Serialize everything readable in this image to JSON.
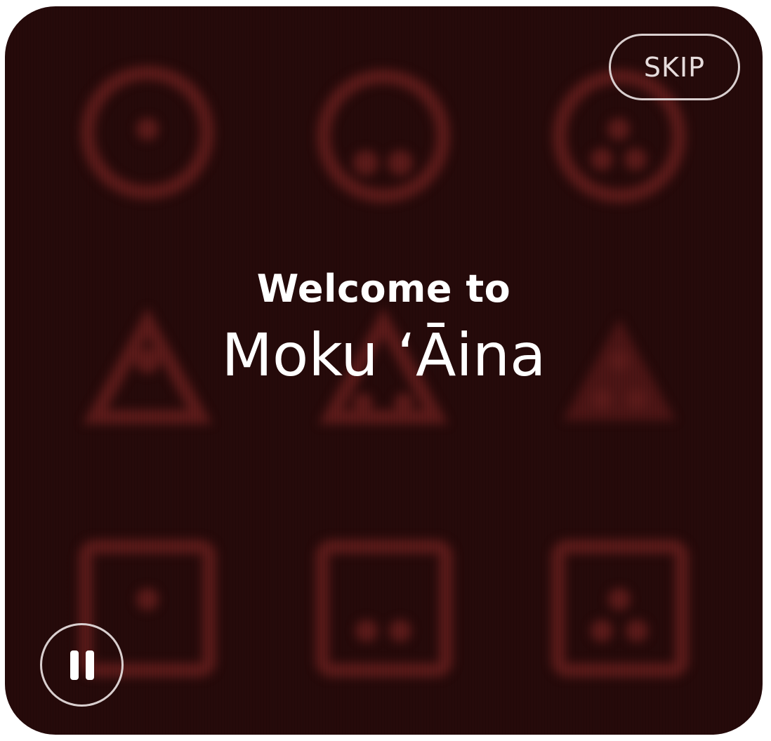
{
  "splash": {
    "welcome_text": "Welcome to",
    "app_name": "Moku ʻĀina"
  },
  "controls": {
    "skip_label": "SKIP",
    "pause_icon": "pause-icon"
  },
  "background": {
    "icons": [
      "circle-dot-icon",
      "circle-two-dots-icon",
      "circle-three-dots-icon",
      "triangle-dot-icon",
      "triangle-two-dots-icon",
      "triangle-three-dots-icon",
      "square-dot-icon",
      "square-two-dots-icon",
      "square-three-dots-icon"
    ]
  },
  "colors": {
    "background": "#260a0a",
    "glyph": "#5c1b1a",
    "text": "#ffffff",
    "outline": "#d9cfcf"
  }
}
